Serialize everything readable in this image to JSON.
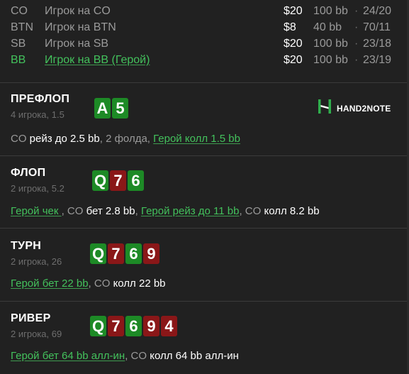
{
  "players": [
    {
      "pos": "CO",
      "name": "Игрок на CO",
      "stake": "$20",
      "bb": "100 bb",
      "sep": "·",
      "ratio": "24/20",
      "hero": false
    },
    {
      "pos": "BTN",
      "name": "Игрок на BTN",
      "stake": "$8",
      "bb": "40 bb",
      "sep": "·",
      "ratio": "70/11",
      "hero": false
    },
    {
      "pos": "SB",
      "name": "Игрок на SB",
      "stake": "$20",
      "bb": "100 bb",
      "sep": "·",
      "ratio": "23/18",
      "hero": false
    },
    {
      "pos": "BB",
      "name": "Игрок на BB (Герой)",
      "stake": "$20",
      "bb": "100 bb",
      "sep": "·",
      "ratio": "23/19",
      "hero": true
    }
  ],
  "logo": {
    "text": "HAND2NOTE",
    "icon": "hand2note-logo-icon"
  },
  "streets": {
    "preflop": {
      "title": "ПРЕФЛОП",
      "sub": "4 игрока, 1.5",
      "cards": [
        {
          "rank": "A",
          "color": "green"
        },
        {
          "rank": "5",
          "color": "green"
        }
      ],
      "actions": [
        {
          "text": "CO ",
          "style": "grey"
        },
        {
          "text": "рейз до 2.5 bb",
          "style": "white"
        },
        {
          "text": ", 2 фолда, ",
          "style": "grey"
        },
        {
          "text": "Герой колл 1.5 bb",
          "style": "hero"
        }
      ]
    },
    "flop": {
      "title": "ФЛОП",
      "sub": "2 игрока, 5.2",
      "cards": [
        {
          "rank": "Q",
          "color": "green"
        },
        {
          "rank": "7",
          "color": "red"
        },
        {
          "rank": "6",
          "color": "green"
        }
      ],
      "actions": [
        {
          "text": "Герой чек ",
          "style": "hero"
        },
        {
          "text": ", CO ",
          "style": "grey"
        },
        {
          "text": "бет 2.8 bb",
          "style": "white"
        },
        {
          "text": ", ",
          "style": "grey"
        },
        {
          "text": "Герой рейз до 11 bb",
          "style": "hero"
        },
        {
          "text": ", CO ",
          "style": "grey"
        },
        {
          "text": "колл 8.2 bb",
          "style": "white"
        }
      ]
    },
    "turn": {
      "title": "ТУРН",
      "sub": "2 игрока, 26",
      "cards": [
        {
          "rank": "Q",
          "color": "green"
        },
        {
          "rank": "7",
          "color": "red"
        },
        {
          "rank": "6",
          "color": "green"
        },
        {
          "rank": "9",
          "color": "red"
        }
      ],
      "actions": [
        {
          "text": "Герой бет 22 bb",
          "style": "hero"
        },
        {
          "text": ", CO ",
          "style": "grey"
        },
        {
          "text": "колл 22 bb",
          "style": "white"
        }
      ]
    },
    "river": {
      "title": "РИВЕР",
      "sub": "2 игрока, 69",
      "cards": [
        {
          "rank": "Q",
          "color": "green"
        },
        {
          "rank": "7",
          "color": "red"
        },
        {
          "rank": "6",
          "color": "green"
        },
        {
          "rank": "9",
          "color": "red"
        },
        {
          "rank": "4",
          "color": "red"
        }
      ],
      "actions": [
        {
          "text": "Герой бет 64 bb алл-ин",
          "style": "hero"
        },
        {
          "text": ", CO ",
          "style": "grey"
        },
        {
          "text": "колл 64 bb алл-ин",
          "style": "white"
        }
      ]
    }
  },
  "colors": {
    "background": "#212121",
    "hero": "#43c15c",
    "card_green": "#1d8a26",
    "card_red": "#8a1718"
  }
}
